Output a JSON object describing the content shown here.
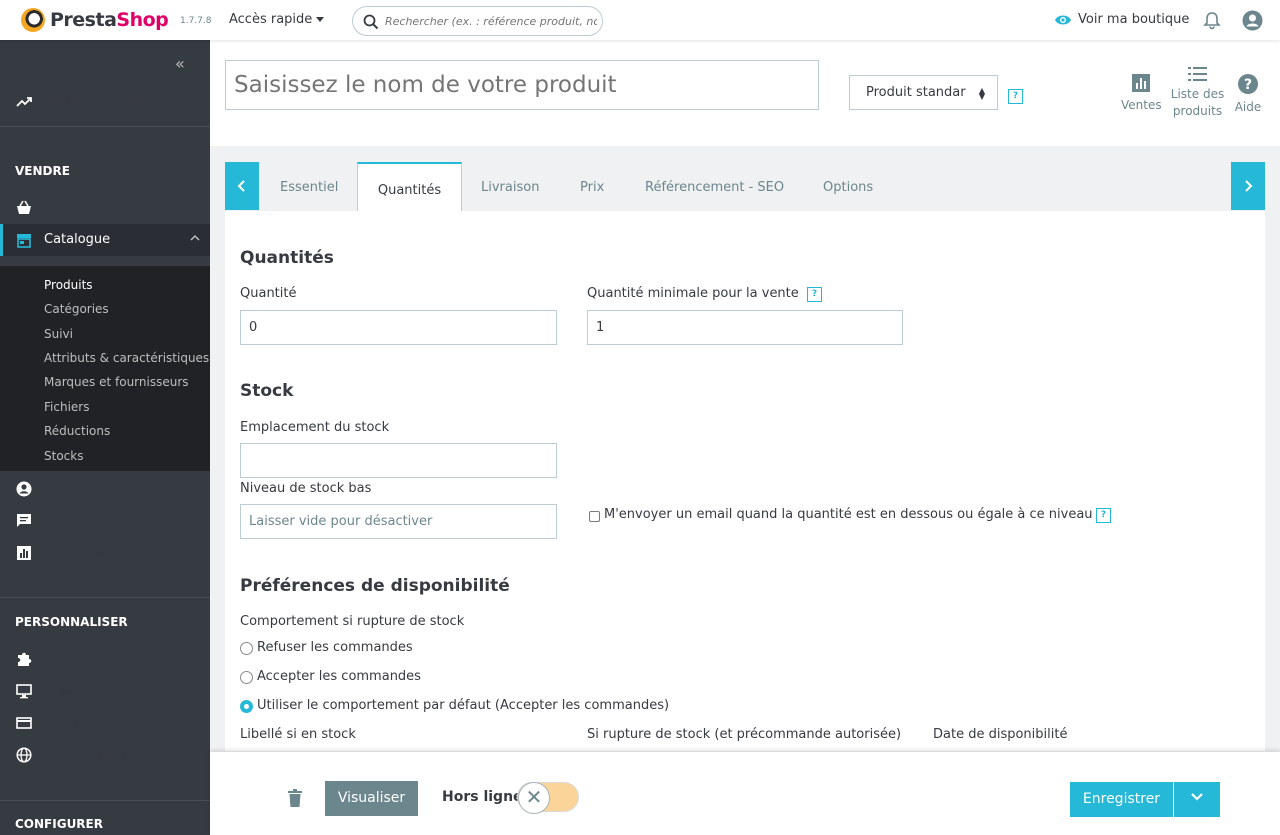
{
  "header": {
    "brand_part1": "Presta",
    "brand_part2": "Shop",
    "version": "1.7.7.8",
    "quick_access": "Accès rapide",
    "search_placeholder": "Rechercher (ex. : référence produit, nom",
    "view_shop": "Voir ma boutique"
  },
  "sidebar": {
    "dashboard": "Tableau de bord",
    "section_sell": "VENDRE",
    "orders": "Commandes",
    "catalog": "Catalogue",
    "catalog_sub": [
      "Produits",
      "Catégories",
      "Suivi",
      "Attributs & caractéristiques",
      "Marques et fournisseurs",
      "Fichiers",
      "Réductions",
      "Stocks"
    ],
    "customers": "Clients",
    "service": "SAV",
    "stats": "Statistiques",
    "section_customize": "PERSONNALISER",
    "modules": "Modules",
    "design": "Apparence",
    "payment": "Paiement",
    "international": "International",
    "section_configure": "CONFIGURER"
  },
  "product_header": {
    "name_placeholder": "Saisissez le nom de votre produit",
    "type": "Produit standar",
    "help_mark": "?",
    "sales": "Ventes",
    "product_list_line1": "Liste des",
    "product_list_line2": "produits",
    "help": "Aide"
  },
  "tabs": [
    "Essentiel",
    "Quantités",
    "Livraison",
    "Prix",
    "Référencement - SEO",
    "Options"
  ],
  "quantities": {
    "title": "Quantités",
    "qty_label": "Quantité",
    "qty_value": "0",
    "min_qty_label": "Quantité minimale pour la vente",
    "min_qty_value": "1"
  },
  "stock": {
    "title": "Stock",
    "location_label": "Emplacement du stock",
    "location_value": "",
    "low_stock_label": "Niveau de stock bas",
    "low_stock_placeholder": "Laisser vide pour désactiver",
    "email_alert_label": "M'envoyer un email quand la quantité est en dessous ou égale à ce niveau"
  },
  "availability": {
    "title": "Préférences de disponibilité",
    "behavior_label": "Comportement si rupture de stock",
    "options": [
      "Refuser les commandes",
      "Accepter les commandes",
      "Utiliser le comportement par défaut (Accepter les commandes)"
    ],
    "selected_index": 2,
    "in_stock_label": "Libellé si en stock",
    "out_of_stock_label": "Si rupture de stock (et précommande autorisée)",
    "availability_date_label": "Date de disponibilité"
  },
  "footer": {
    "preview": "Visualiser",
    "offline": "Hors ligne",
    "save": "Enregistrer"
  },
  "colors": {
    "accent": "#25b9d7",
    "sidebar_bg": "#363a41",
    "brand_pink": "#df0067"
  }
}
